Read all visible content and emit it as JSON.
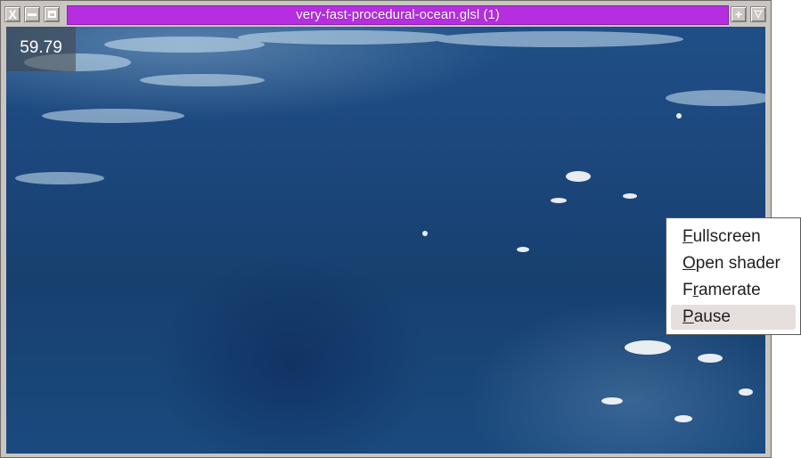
{
  "window": {
    "title": "very-fast-procedural-ocean.glsl (1)",
    "title_color": "#b52ee0",
    "buttons": {
      "close": "close-icon",
      "minimize": "minimize-icon",
      "restore": "restore-icon",
      "maximize": "maximize-icon",
      "menu": "chevron-down-icon"
    }
  },
  "overlay": {
    "fps": "59.79"
  },
  "context_menu": {
    "items": [
      {
        "mnemonic": "F",
        "rest": "ullscreen"
      },
      {
        "mnemonic": "O",
        "rest": "pen shader"
      },
      {
        "pre": "F",
        "mnemonic": "r",
        "rest": "amerate"
      },
      {
        "mnemonic": "P",
        "rest": "ause",
        "highlighted": true
      }
    ]
  }
}
